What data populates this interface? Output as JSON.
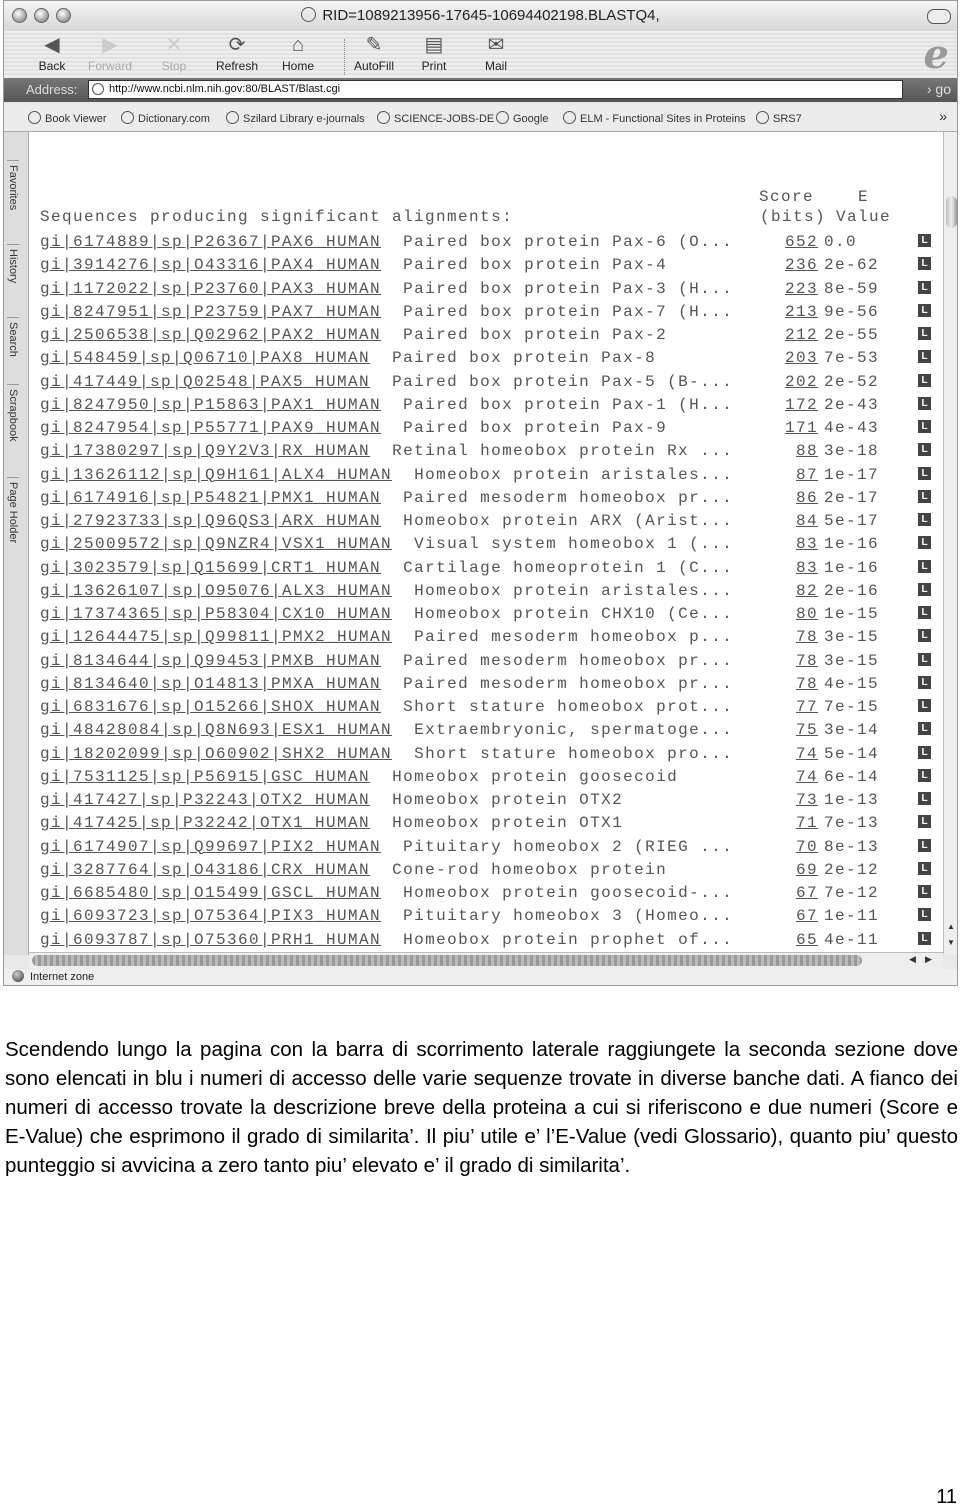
{
  "browser": {
    "window_title": "RID=1089213956-17645-10694402198.BLASTQ4,",
    "toolbar": [
      {
        "label": "Back",
        "icon": "back-arrow-icon",
        "enabled": true
      },
      {
        "label": "Forward",
        "icon": "forward-arrow-icon",
        "enabled": false
      },
      {
        "label": "Stop",
        "icon": "stop-x-icon",
        "enabled": false
      },
      {
        "label": "Refresh",
        "icon": "refresh-icon",
        "enabled": true
      },
      {
        "label": "Home",
        "icon": "home-icon",
        "enabled": true
      },
      {
        "label": "AutoFill",
        "icon": "autofill-pen-icon",
        "enabled": true
      },
      {
        "label": "Print",
        "icon": "printer-icon",
        "enabled": true
      },
      {
        "label": "Mail",
        "icon": "mail-icon",
        "enabled": true
      }
    ],
    "address_label": "Address:",
    "address_url": "http://www.ncbi.nlm.nih.gov:80/BLAST/Blast.cgi",
    "go_label": "go",
    "bookmarks": [
      "Book Viewer",
      "Dictionary.com",
      "Szilard Library e-journals",
      "SCIENCE-JOBS-DE",
      "Google",
      "ELM - Functional Sites in Proteins",
      "SRS7"
    ],
    "side_tabs": [
      "Favorites",
      "History",
      "Search",
      "Scrapbook",
      "Page Holder"
    ],
    "status": "Internet zone"
  },
  "results": {
    "heading": "Sequences producing significant alignments:",
    "score_header_1": "Score",
    "score_header_2": "(bits)",
    "evalue_header_1": "E",
    "evalue_header_2": "Value",
    "link_icon_label": "L",
    "rows": [
      {
        "id": "gi|6174889|sp|P26367|PAX6_HUMAN",
        "desc": "Paired box protein Pax-6 (O...",
        "score": "652",
        "evalue": "0.0"
      },
      {
        "id": "gi|3914276|sp|O43316|PAX4_HUMAN",
        "desc": "Paired box protein Pax-4",
        "score": "236",
        "evalue": "2e-62"
      },
      {
        "id": "gi|1172022|sp|P23760|PAX3_HUMAN",
        "desc": "Paired box protein Pax-3 (H...",
        "score": "223",
        "evalue": "8e-59"
      },
      {
        "id": "gi|8247951|sp|P23759|PAX7_HUMAN",
        "desc": "Paired box protein Pax-7 (H...",
        "score": "213",
        "evalue": "9e-56"
      },
      {
        "id": "gi|2506538|sp|Q02962|PAX2_HUMAN",
        "desc": "Paired box protein Pax-2",
        "score": "212",
        "evalue": "2e-55"
      },
      {
        "id": "gi|548459|sp|Q06710|PAX8_HUMAN",
        "desc": "Paired box protein Pax-8",
        "score": "203",
        "evalue": "7e-53"
      },
      {
        "id": "gi|417449|sp|Q02548|PAX5_HUMAN",
        "desc": "Paired box protein Pax-5 (B-...",
        "score": "202",
        "evalue": "2e-52"
      },
      {
        "id": "gi|8247950|sp|P15863|PAX1_HUMAN",
        "desc": "Paired box protein Pax-1 (H...",
        "score": "172",
        "evalue": "2e-43"
      },
      {
        "id": "gi|8247954|sp|P55771|PAX9_HUMAN",
        "desc": "Paired box protein Pax-9",
        "score": "171",
        "evalue": "4e-43"
      },
      {
        "id": "gi|17380297|sp|Q9Y2V3|RX_HUMAN",
        "desc": "Retinal homeobox protein Rx ...",
        "score": "88",
        "evalue": "3e-18"
      },
      {
        "id": "gi|13626112|sp|Q9H161|ALX4_HUMAN",
        "desc": "Homeobox protein aristales...",
        "score": "87",
        "evalue": "1e-17"
      },
      {
        "id": "gi|6174916|sp|P54821|PMX1_HUMAN",
        "desc": "Paired mesoderm homeobox pr...",
        "score": "86",
        "evalue": "2e-17"
      },
      {
        "id": "gi|27923733|sp|Q96QS3|ARX_HUMAN",
        "desc": "Homeobox protein ARX (Arist...",
        "score": "84",
        "evalue": "5e-17"
      },
      {
        "id": "gi|25009572|sp|Q9NZR4|VSX1_HUMAN",
        "desc": "Visual system homeobox 1 (...",
        "score": "83",
        "evalue": "1e-16"
      },
      {
        "id": "gi|3023579|sp|Q15699|CRT1_HUMAN",
        "desc": "Cartilage homeoprotein 1 (C...",
        "score": "83",
        "evalue": "1e-16"
      },
      {
        "id": "gi|13626107|sp|O95076|ALX3_HUMAN",
        "desc": "Homeobox protein aristales...",
        "score": "82",
        "evalue": "2e-16"
      },
      {
        "id": "gi|17374365|sp|P58304|CX10_HUMAN",
        "desc": "Homeobox protein CHX10 (Ce...",
        "score": "80",
        "evalue": "1e-15"
      },
      {
        "id": "gi|12644475|sp|Q99811|PMX2_HUMAN",
        "desc": "Paired mesoderm homeobox p...",
        "score": "78",
        "evalue": "3e-15"
      },
      {
        "id": "gi|8134644|sp|Q99453|PMXB_HUMAN",
        "desc": "Paired mesoderm homeobox pr...",
        "score": "78",
        "evalue": "3e-15"
      },
      {
        "id": "gi|8134640|sp|O14813|PMXA_HUMAN",
        "desc": "Paired mesoderm homeobox pr...",
        "score": "78",
        "evalue": "4e-15"
      },
      {
        "id": "gi|6831676|sp|O15266|SHOX_HUMAN",
        "desc": "Short stature homeobox prot...",
        "score": "77",
        "evalue": "7e-15"
      },
      {
        "id": "gi|48428084|sp|Q8N693|ESX1_HUMAN",
        "desc": "Extraembryonic, spermatoge...",
        "score": "75",
        "evalue": "3e-14"
      },
      {
        "id": "gi|18202099|sp|O60902|SHX2_HUMAN",
        "desc": "Short stature homeobox pro...",
        "score": "74",
        "evalue": "5e-14"
      },
      {
        "id": "gi|7531125|sp|P56915|GSC_HUMAN",
        "desc": "Homeobox protein goosecoid",
        "score": "74",
        "evalue": "6e-14"
      },
      {
        "id": "gi|417427|sp|P32243|OTX2_HUMAN",
        "desc": "Homeobox protein OTX2",
        "score": "73",
        "evalue": "1e-13"
      },
      {
        "id": "gi|417425|sp|P32242|OTX1_HUMAN",
        "desc": "Homeobox protein OTX1",
        "score": "71",
        "evalue": "7e-13"
      },
      {
        "id": "gi|6174907|sp|Q99697|PIX2_HUMAN",
        "desc": "Pituitary homeobox 2 (RIEG ...",
        "score": "70",
        "evalue": "8e-13"
      },
      {
        "id": "gi|3287764|sp|O43186|CRX_HUMAN",
        "desc": "Cone-rod homeobox protein",
        "score": "69",
        "evalue": "2e-12"
      },
      {
        "id": "gi|6685480|sp|O15499|GSCL_HUMAN",
        "desc": "Homeobox protein goosecoid-...",
        "score": "67",
        "evalue": "7e-12"
      },
      {
        "id": "gi|6093723|sp|O75364|PIX3_HUMAN",
        "desc": "Pituitary homeobox 3 (Homeo...",
        "score": "67",
        "evalue": "1e-11"
      },
      {
        "id": "gi|6093787|sp|O75360|PRH1_HUMAN",
        "desc": "Homeobox protein prophet of...",
        "score": "65",
        "evalue": "4e-11"
      }
    ]
  },
  "document": {
    "paragraph": "Scendendo lungo la pagina con la barra di scorrimento laterale raggiungete la seconda sezione dove sono elencati in blu i numeri di accesso delle varie sequenze trovate in diverse banche dati. A fianco dei numeri di accesso trovate la descrizione breve della proteina a cui si riferiscono e due numeri (Score e E-Value) che esprimono il grado di similarita’. Il piu’ utile e’ l’E-Value (vedi Glossario), quanto piu’ questo punteggio si avvicina a zero tanto piu’ elevato e’ il grado di similarita’.",
    "page_number": "11"
  }
}
